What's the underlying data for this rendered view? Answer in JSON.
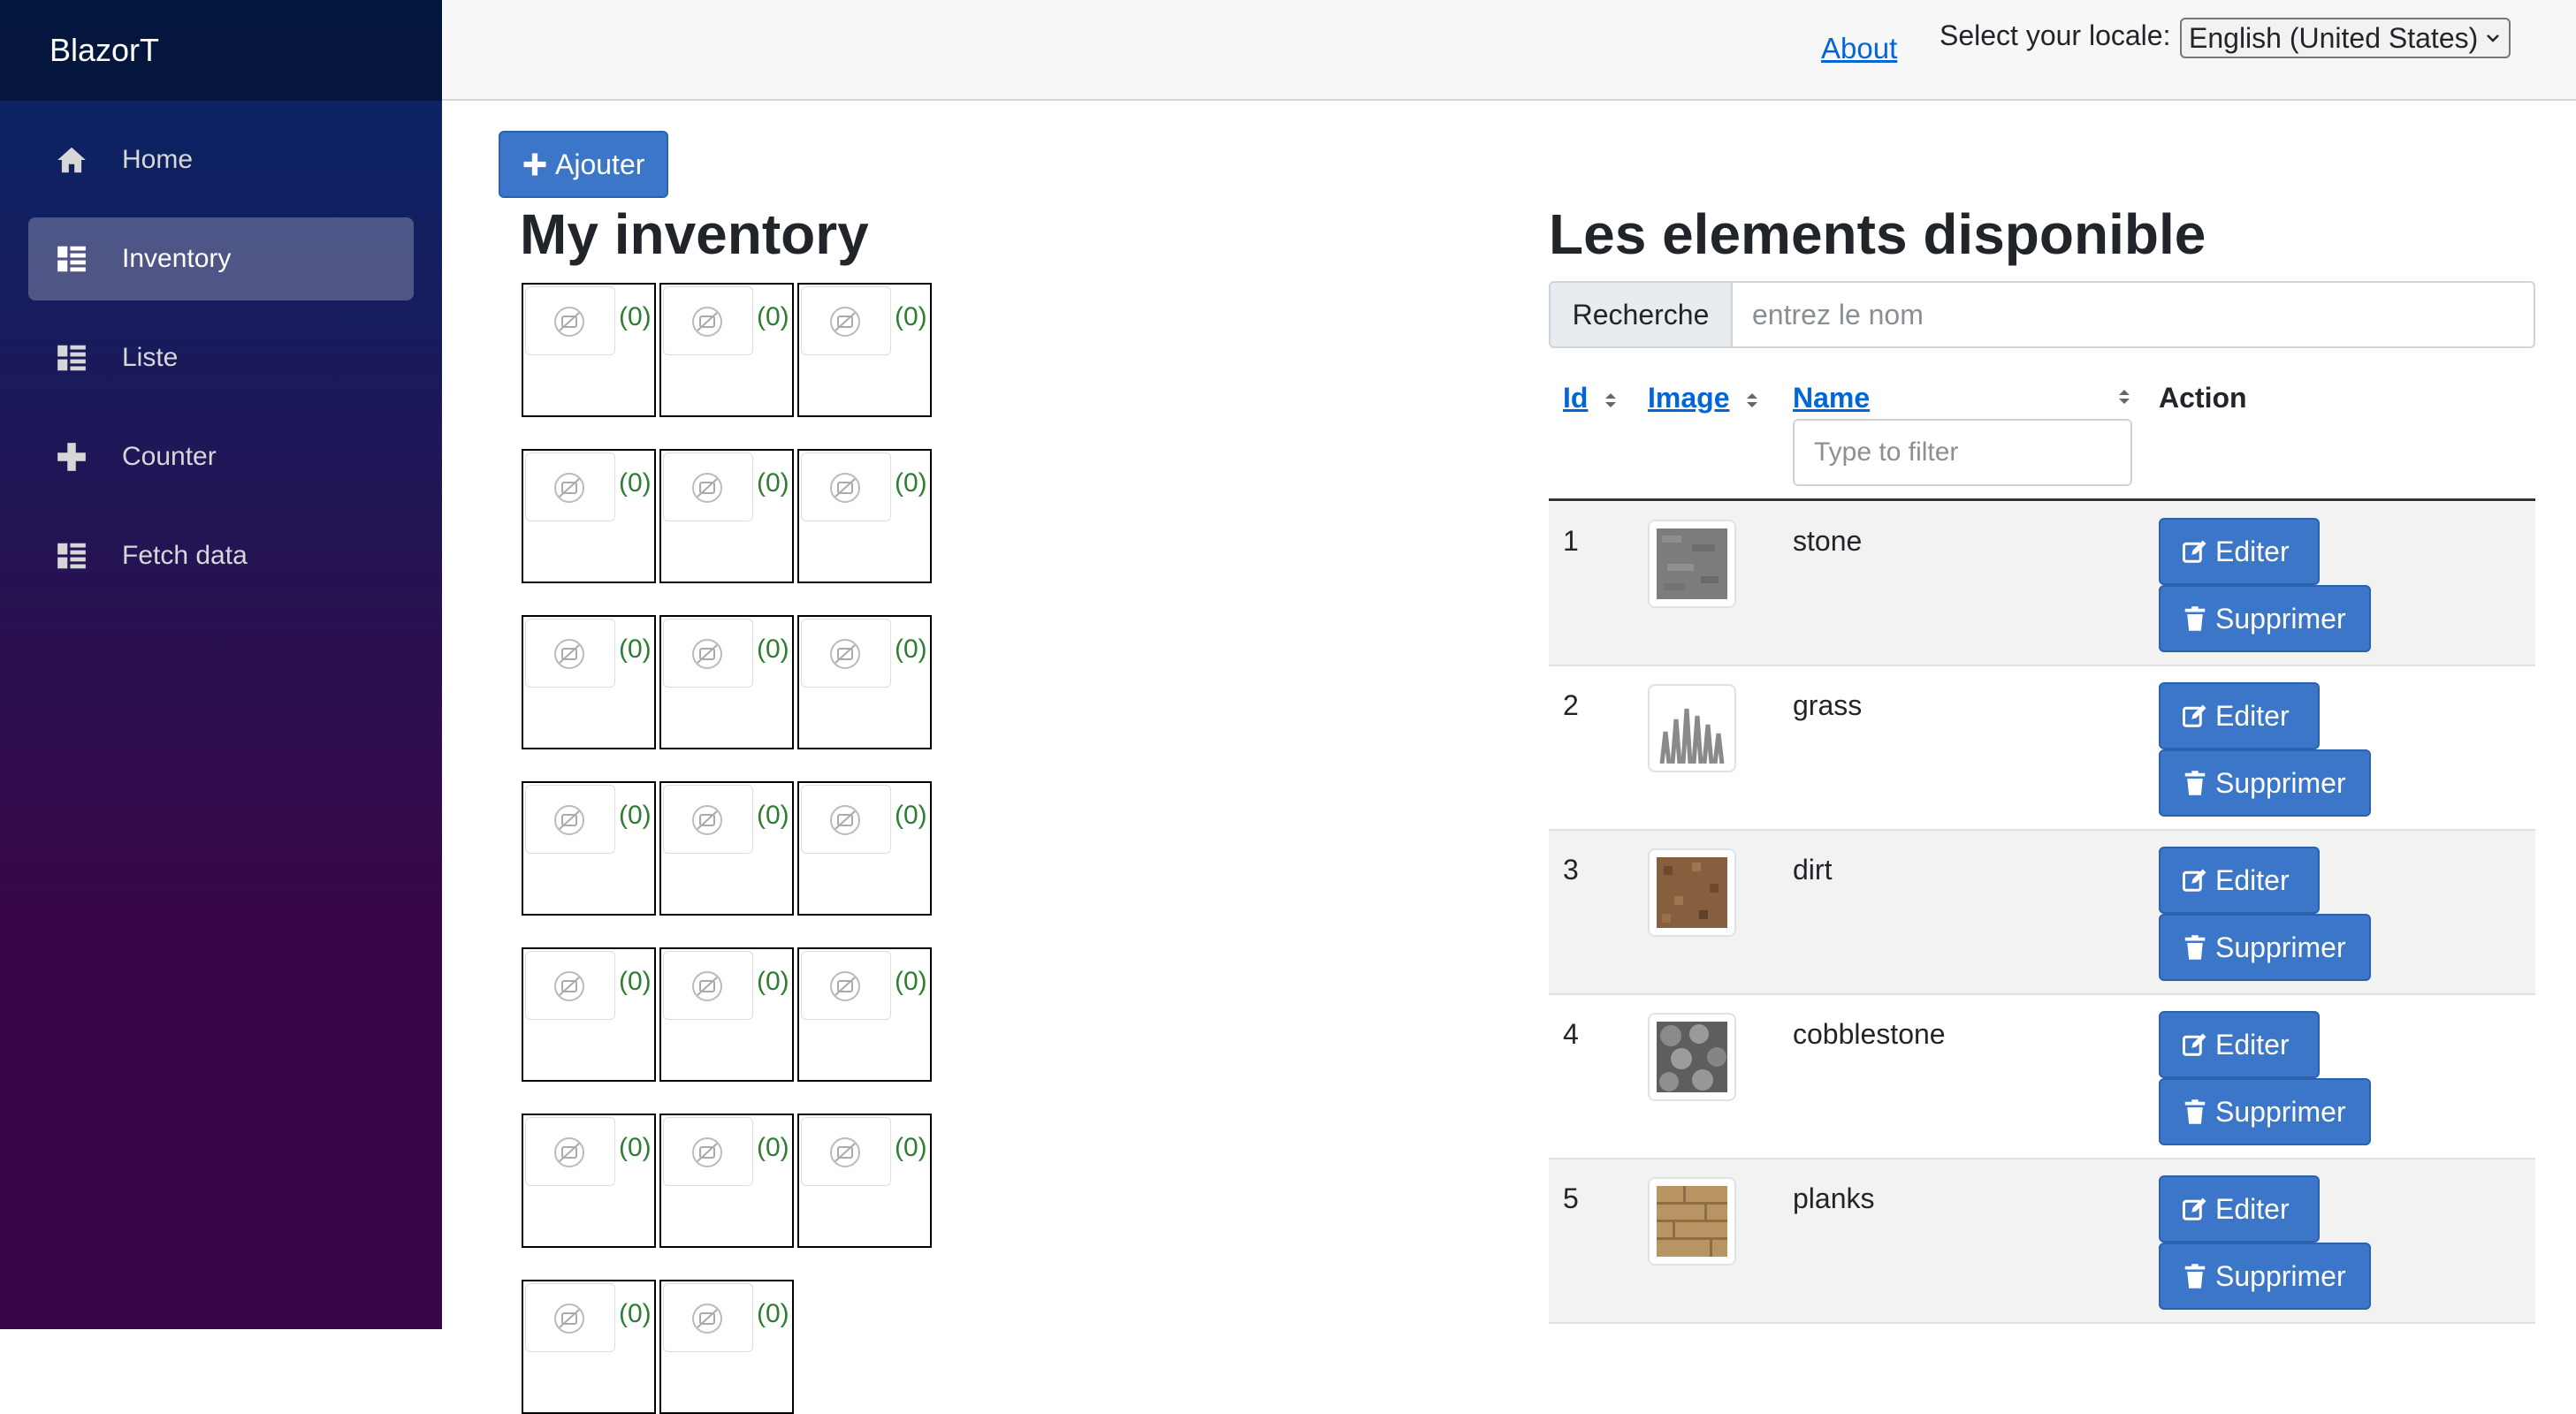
{
  "brand": "BlazorT",
  "nav": [
    {
      "label": "Home",
      "icon": "home-icon",
      "active": false
    },
    {
      "label": "Inventory",
      "icon": "list-icon",
      "active": true
    },
    {
      "label": "Liste",
      "icon": "list-icon",
      "active": false
    },
    {
      "label": "Counter",
      "icon": "plus-icon",
      "active": false
    },
    {
      "label": "Fetch data",
      "icon": "list-icon",
      "active": false
    }
  ],
  "top": {
    "about": "About",
    "locale_label": "Select your locale:",
    "locale_value": "English (United States)"
  },
  "add_button": "Ajouter",
  "inventory": {
    "title": "My inventory",
    "slot_count": "(0)"
  },
  "available": {
    "title": "Les elements disponible",
    "search_label": "Recherche",
    "search_placeholder": "entrez le nom",
    "headers": {
      "id": "Id",
      "image": "Image",
      "name": "Name",
      "action": "Action"
    },
    "filter_placeholder": "Type to filter",
    "edit_label": "Editer",
    "delete_label": "Supprimer",
    "rows": [
      {
        "id": "1",
        "name": "stone"
      },
      {
        "id": "2",
        "name": "grass"
      },
      {
        "id": "3",
        "name": "dirt"
      },
      {
        "id": "4",
        "name": "cobblestone"
      },
      {
        "id": "5",
        "name": "planks"
      }
    ]
  }
}
